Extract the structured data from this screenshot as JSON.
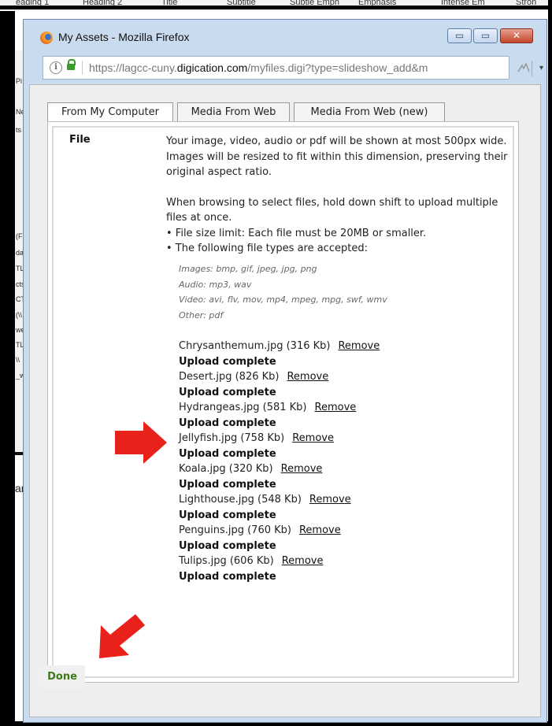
{
  "background": {
    "ribbon_items": [
      "eading 1",
      "Heading 2",
      "Title",
      "Subtitle",
      "Subtle Emph",
      "Emphasis",
      "Intense Em",
      "Stron"
    ],
    "side_fragments": [
      "Pi",
      "Ne",
      "ts",
      "(F:)",
      "dat",
      "TL_",
      "cts",
      "CTL",
      "(\\\\",
      "wel",
      "TL_",
      "\\\\",
      "_we"
    ],
    "side_word": "ar"
  },
  "window": {
    "title": "My Assets - Mozilla Firefox",
    "controls": {
      "minimize": "▭",
      "maximize": "▭",
      "close": "✕"
    },
    "url": {
      "prefix": "https://lagcc-cuny.",
      "domain": "digication.com",
      "suffix": "/myfiles.digi?type=slideshow_add&m"
    }
  },
  "tabs": [
    "From My Computer",
    "Media From Web",
    "Media From Web (new)"
  ],
  "form": {
    "label": "File",
    "description": [
      "Your image, video, audio or pdf will be shown at most 500px wide. Images will be resized to fit within this dimension, preserving their original aspect ratio.",
      "When browsing to select files, hold down shift to upload multiple files at once.",
      "• File size limit: Each file must be 20MB or smaller.",
      "• The following file types are accepted:"
    ],
    "accepted_types": [
      "Images: bmp, gif, jpeg, jpg, png",
      "Audio: mp3, wav",
      "Video: avi, flv, mov, mp4, mpeg, mpg, swf, wmv",
      "Other: pdf"
    ],
    "uploads": [
      {
        "file": "Chrysanthemum.jpg (316 Kb)",
        "action": "Remove",
        "status": "Upload complete"
      },
      {
        "file": "Desert.jpg (826 Kb)",
        "action": "Remove",
        "status": "Upload complete"
      },
      {
        "file": "Hydrangeas.jpg (581 Kb)",
        "action": "Remove",
        "status": "Upload complete"
      },
      {
        "file": "Jellyfish.jpg (758 Kb)",
        "action": "Remove",
        "status": "Upload complete"
      },
      {
        "file": "Koala.jpg (320 Kb)",
        "action": "Remove",
        "status": "Upload complete"
      },
      {
        "file": "Lighthouse.jpg (548 Kb)",
        "action": "Remove",
        "status": "Upload complete"
      },
      {
        "file": "Penguins.jpg (760 Kb)",
        "action": "Remove",
        "status": "Upload complete"
      },
      {
        "file": "Tulips.jpg (606 Kb)",
        "action": "Remove",
        "status": "Upload complete"
      }
    ]
  },
  "done_label": "Done",
  "colors": {
    "arrow": "#e8211b",
    "done_text": "#3d7a1a",
    "window_frame": "#c9dbef"
  }
}
